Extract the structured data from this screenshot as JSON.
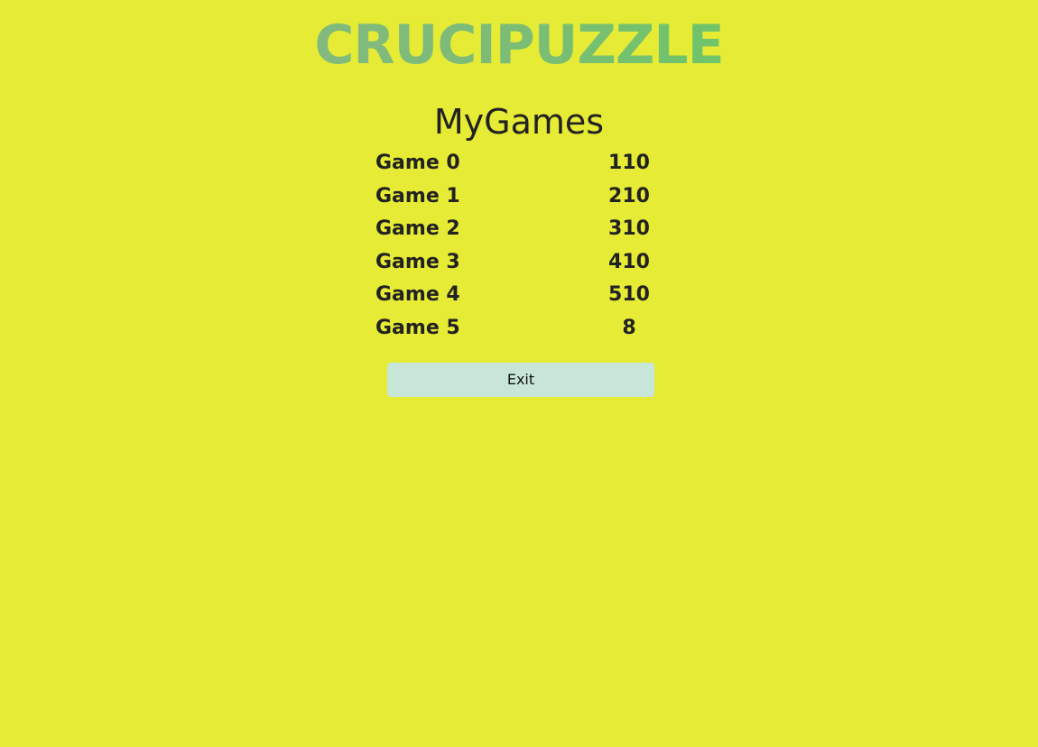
{
  "header": {
    "logo_text": "CRUCIPUZZLE"
  },
  "main": {
    "title": "MyGames",
    "games": [
      {
        "name": "Game 0",
        "score": "110"
      },
      {
        "name": "Game 1",
        "score": "210"
      },
      {
        "name": "Game 2",
        "score": "310"
      },
      {
        "name": "Game 3",
        "score": "410"
      },
      {
        "name": "Game 4",
        "score": "510"
      },
      {
        "name": "Game 5",
        "score": "8"
      }
    ],
    "exit_label": "Exit"
  },
  "colors": {
    "background": "#e6eb35",
    "logo_gradient_start": "#8cb98a",
    "logo_gradient_end": "#5fcf58",
    "text": "#222222",
    "exit_button_bg": "#c8e6d8"
  }
}
